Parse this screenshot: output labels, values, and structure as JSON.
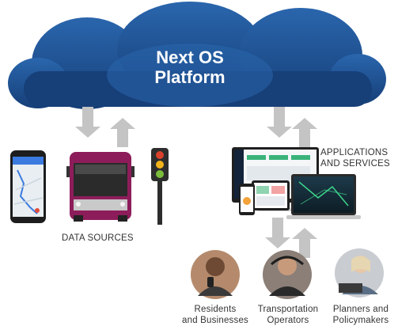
{
  "platform": {
    "title_line1": "Next OS",
    "title_line2": "Platform"
  },
  "labels": {
    "data_sources": "DATA SOURCES",
    "applications_line1": "APPLICATIONS",
    "applications_line2": "AND SERVICES"
  },
  "stakeholders": [
    {
      "line1": "Residents",
      "line2": "and Businesses",
      "icon": "woman-with-phone"
    },
    {
      "line1": "Transportation",
      "line2": "Operators",
      "icon": "man-with-headset"
    },
    {
      "line1": "Planners and",
      "line2": "Policymakers",
      "icon": "woman-at-laptop"
    }
  ],
  "colors": {
    "cloud": "#1b4f8f",
    "cloud_light": "#2a66ad",
    "arrow": "#c4c4c4",
    "bus": "#8d1d5a"
  }
}
